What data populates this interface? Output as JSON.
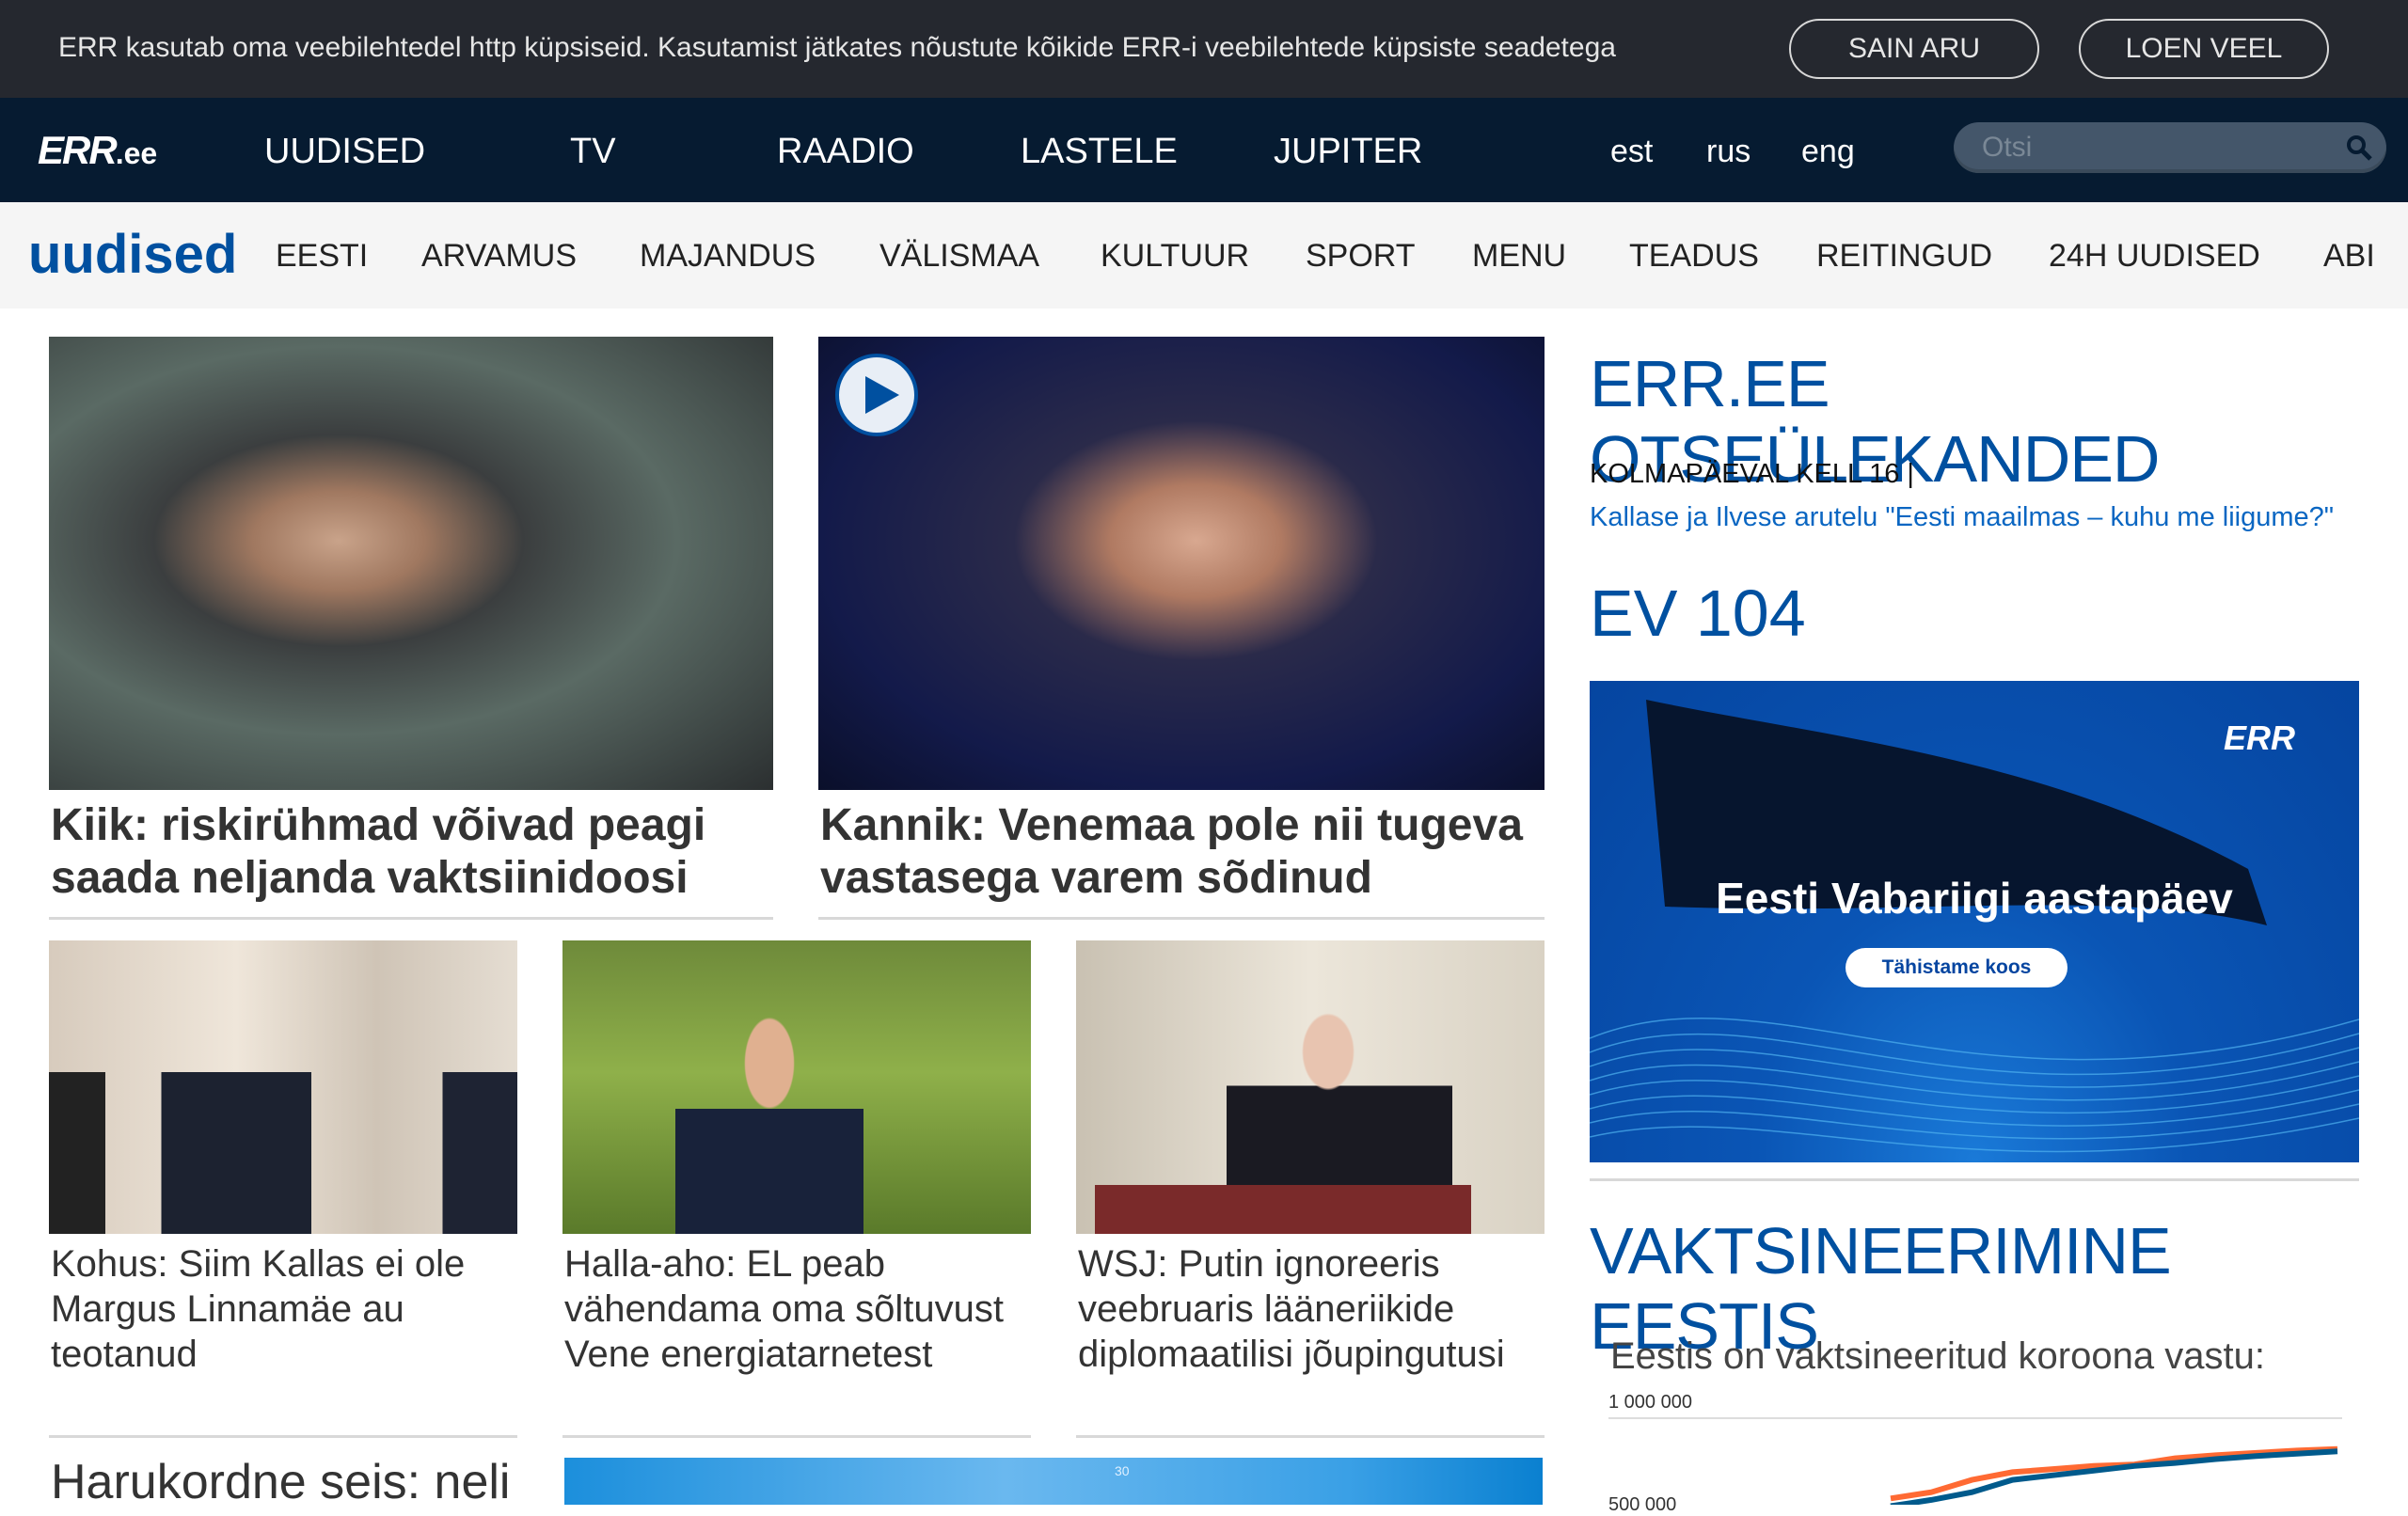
{
  "cookie": {
    "text": "ERR kasutab oma veebilehtedel http küpsiseid. Kasutamist jätkates nõustute kõikide ERR-i veebilehtede küpsiste seadetega",
    "accept": "SAIN ARU",
    "more": "LOEN VEEL"
  },
  "nav": {
    "logo": "ERR",
    "logo_suffix": ".ee",
    "items": [
      "UUDISED",
      "TV",
      "RAADIO",
      "LASTELE",
      "JUPITER"
    ],
    "langs": [
      "est",
      "rus",
      "eng"
    ],
    "search_placeholder": "Otsi"
  },
  "subnav": {
    "brand": "uudised",
    "items": [
      "EESTI",
      "ARVAMUS",
      "MAJANDUS",
      "VÄLISMAA",
      "KULTUUR",
      "SPORT",
      "MENU",
      "TEADUS",
      "REITINGUD",
      "24H UUDISED",
      "ABI"
    ]
  },
  "articles": {
    "top": [
      {
        "title": "Kiik: riskirühmad võivad peagi saada neljanda vaktsiinidoosi"
      },
      {
        "title": "Kannik: Venemaa pole nii tugeva vastasega varem sõdinud",
        "video": true
      }
    ],
    "row": [
      {
        "title": "Kohus: Siim Kallas ei ole Margus Linnamäe au teotanud"
      },
      {
        "title": "Halla-aho: EL peab vähendama oma sõltuvust Vene energiatarnetest"
      },
      {
        "title": "WSJ: Putin ignoreeris veebruaris lääneriikide diplomaatilisi jõupingutusi"
      }
    ],
    "bottom_title": "Harukordne seis: neli",
    "bottom_chart_tick": "30"
  },
  "sidebar": {
    "live_title": "ERR.EE OTSEÜLEKANDED",
    "live_time": "KOLMAPÄEVAL KELL 16 |",
    "live_link": "Kallase ja Ilvese arutelu \"Eesti maailmas – kuhu me liigume?\"",
    "ev_title": "EV 104",
    "banner": {
      "logo": "ERR",
      "title": "Eesti Vabariigi aastapäev",
      "button": "Tähistame koos"
    },
    "vax_title": "VAKTSINEERIMINE EESTIS"
  },
  "chart_data": {
    "type": "line",
    "title": "Eestis on vaktsineeritud koroona vastu:",
    "ytick_labels": [
      "1 000 000",
      "500 000"
    ],
    "ylim": [
      0,
      1000000
    ],
    "series": [
      {
        "color": "#ff6a33",
        "values": [
          480000,
          520000,
          600000,
          650000,
          670000,
          690000,
          700000,
          740000,
          760000,
          775000,
          790000,
          800000
        ]
      },
      {
        "color": "#005a8c",
        "values": [
          430000,
          470000,
          520000,
          600000,
          630000,
          660000,
          690000,
          710000,
          735000,
          755000,
          770000,
          785000
        ]
      }
    ]
  },
  "colors": {
    "brand": "#0050a0",
    "nav": "#061b31",
    "cookie": "#25282f"
  }
}
